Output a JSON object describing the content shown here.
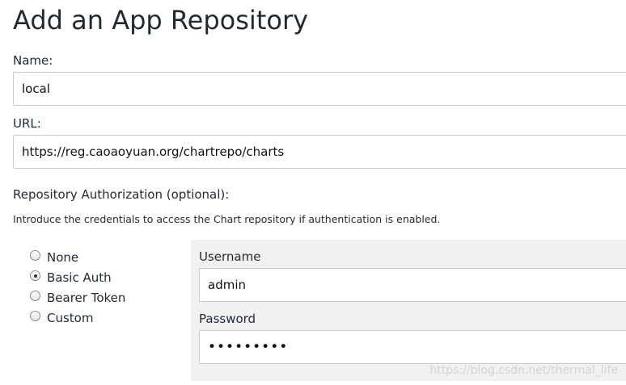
{
  "page": {
    "title": "Add an App Repository"
  },
  "form": {
    "name": {
      "label": "Name:",
      "value": "local"
    },
    "url": {
      "label": "URL:",
      "value": "https://reg.caoaoyuan.org/chartrepo/charts"
    },
    "authorization": {
      "heading": "Repository Authorization (optional):",
      "hint": "Introduce the credentials to access the Chart repository if authentication is enabled.",
      "options": [
        {
          "label": "None",
          "checked": false
        },
        {
          "label": "Basic Auth",
          "checked": true
        },
        {
          "label": "Bearer Token",
          "checked": false
        },
        {
          "label": "Custom",
          "checked": false
        }
      ],
      "username": {
        "label": "Username",
        "value": "admin"
      },
      "password": {
        "label": "Password",
        "value": "•••••••••"
      }
    }
  },
  "watermark": "https://blog.csdn.net/thermal_life"
}
